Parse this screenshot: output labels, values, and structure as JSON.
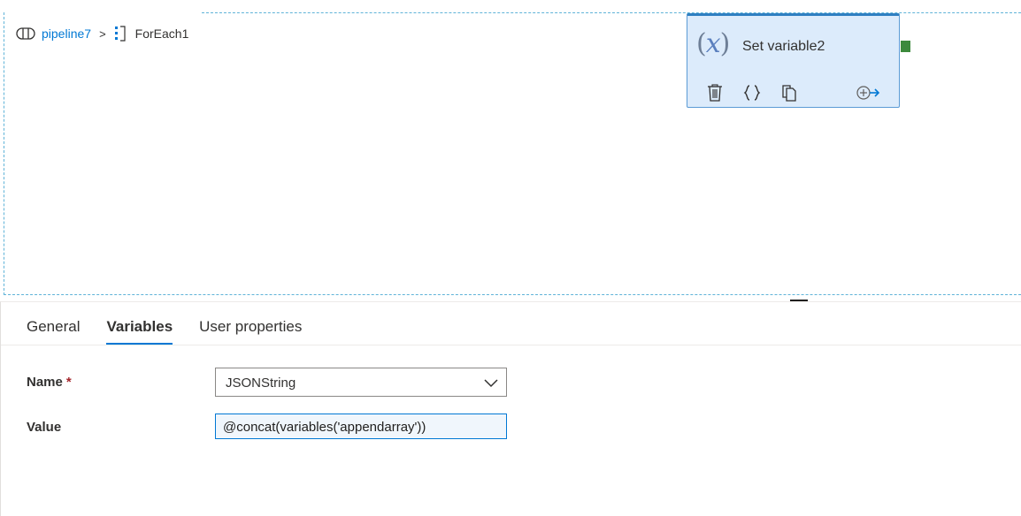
{
  "breadcrumb": {
    "pipeline": "pipeline7",
    "separator": ">",
    "current": "ForEach1"
  },
  "activity": {
    "icon_text": "x",
    "title": "Set variable2",
    "tools": [
      "delete-icon",
      "code-icon",
      "copy-icon",
      "add-output-icon"
    ]
  },
  "tabs": [
    {
      "label": "General",
      "active": false
    },
    {
      "label": "Variables",
      "active": true
    },
    {
      "label": "User properties",
      "active": false
    }
  ],
  "form": {
    "name_label": "Name",
    "required_marker": "*",
    "name_value": "JSONString",
    "value_label": "Value",
    "value_value": "@concat(variables('appendarray'))"
  },
  "colors": {
    "accent": "#0078d4",
    "activity_bg": "#dcebfb",
    "success_port": "#3c8a3c"
  }
}
